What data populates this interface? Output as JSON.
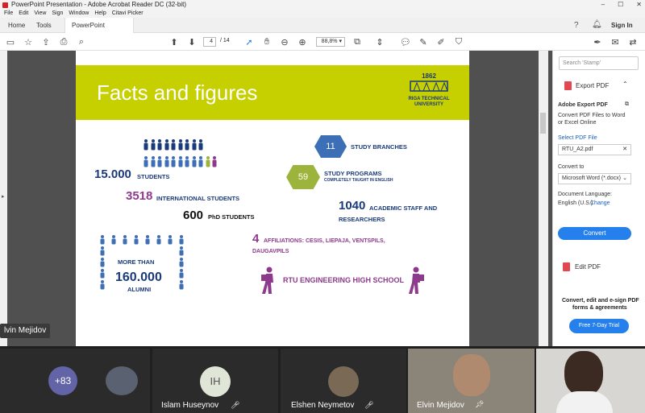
{
  "window": {
    "title": "PowerPoint Presentation - Adobe Acrobat Reader DC (32-bit)"
  },
  "menu": [
    "File",
    "Edit",
    "View",
    "Sign",
    "Window",
    "Help",
    "Citavi Picker"
  ],
  "tabs": {
    "home": "Home",
    "tools": "Tools",
    "doc": "PowerPoint Presen...",
    "signin": "Sign In"
  },
  "toolbar": {
    "page_current": "4",
    "page_total": "/ 14",
    "zoom": "88,8%"
  },
  "slide": {
    "title": "Facts and figures",
    "logo_year": "1862",
    "logo_name": "RIGA TECHNICAL UNIVERSITY",
    "students_num": "15.000",
    "students_label": "STUDENTS",
    "intl_num": "3518",
    "intl_label": "INTERNATIONAL STUDENTS",
    "phd_num": "600",
    "phd_label": "PhD STUDENTS",
    "branches_num": "11",
    "branches_label": "STUDY BRANCHES",
    "programs_num": "59",
    "programs_label": "STUDY PROGRAMS",
    "programs_sub": "COMPLETELY TAUGHT IN ENGLISH",
    "staff_num": "1040",
    "staff_label_1": "ACADEMIC STAFF AND",
    "staff_label_2": "RESEARCHERS",
    "alumni_more": "MORE THAN",
    "alumni_num": "160.000",
    "alumni_label": "ALUMNI",
    "affil_num": "4",
    "affil_label_1": "AFFILIATIONS: CESIS, LIEPAJA, VENTSPILS,",
    "affil_label_2": "DAUGAVPILS",
    "school": "RTU ENGINEERING HIGH SCHOOL"
  },
  "panel": {
    "search_placeholder": "Search 'Stamp'",
    "export_title": "Export PDF",
    "adobe_export": "Adobe Export PDF",
    "desc_1": "Convert PDF Files to Word",
    "desc_2": "or Excel Online",
    "select_label": "Select PDF File",
    "file_name": "RTU_A2.pdf",
    "convert_to": "Convert to",
    "format": "Microsoft Word (*.docx)",
    "lang_label": "Document Language:",
    "lang_value": "English (U.S.)",
    "change": "Change",
    "convert_btn": "Convert",
    "edit_pdf": "Edit PDF",
    "promo_1": "Convert, edit and e-sign PDF",
    "promo_2": "forms & agreements",
    "trial_btn": "Free 7-Day Trial"
  },
  "video": {
    "speaker_tag": "lvin Mejidov",
    "more_count": "+83",
    "p1_initials": "IH",
    "p1_name": "Islam Huseynov",
    "p2_name": "Elshen Neymetov",
    "p3_name": "Elvin Mejidov"
  },
  "colors": {
    "band": "#c6cf00",
    "navy": "#1a3a7a",
    "purple": "#8e3a8c",
    "blue_hex": "#3d6fb6",
    "green_hex": "#9cb43c",
    "accent": "#2680eb"
  }
}
